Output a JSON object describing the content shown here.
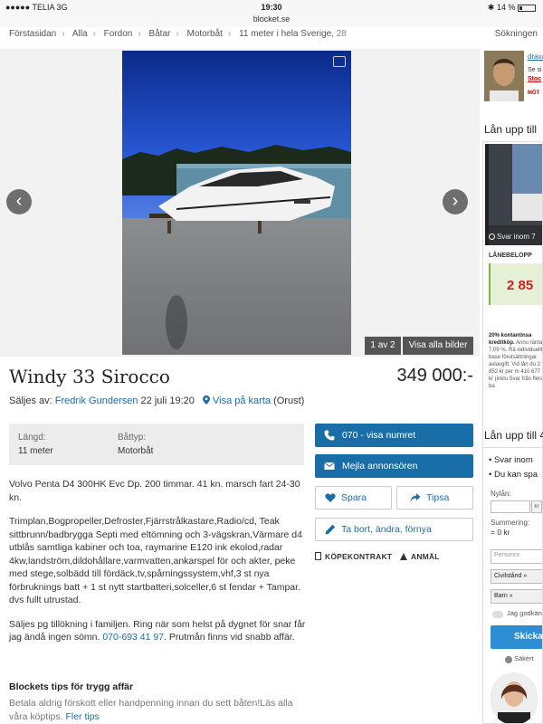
{
  "status_bar": {
    "carrier": "●●●●● TELIA  3G",
    "time": "19:30",
    "url": "blocket.se",
    "battery": "✱ 14 %"
  },
  "breadcrumb": {
    "items": [
      "Förstasidan",
      "Alla",
      "Fordon",
      "Båtar",
      "Motorbåt",
      "11 meter i hela Sverige,"
    ],
    "count": "28",
    "search_link": "Sökningen"
  },
  "gallery": {
    "counter": "1 av 2",
    "show_all": "Visa alla bilder",
    "prev_icon": "chevron-left-icon",
    "next_icon": "chevron-right-icon",
    "prev_glyph": "‹",
    "next_glyph": "›"
  },
  "listing": {
    "title": "Windy 33 Sirocco",
    "price": "349 000:-",
    "seller_prefix": "Säljes av:",
    "seller_name": "Fredrik Gundersen",
    "date": "22 juli 19:20",
    "map_link": "Visa på karta",
    "location": "(Orust)"
  },
  "info": {
    "length_label": "Längd:",
    "length_value": "11 meter",
    "type_label": "Båttyp:",
    "type_value": "Motorbåt"
  },
  "description": {
    "p1": "Volvo Penta D4 300HK Evc Dp. 200 timmar. 41 kn. marsch fart 24-30 kn.",
    "p2": "Trimplan,Bogpropeller,Defroster,Fjärrstrålkastare,Radio/cd, Teak sittbrunn/badbrygga Septi med eltömning och 3-vägskran,Värmare d4 utblås samtliga kabiner och toa, raymarine E120 ink ekolod,radar 4kw,landström,dildohållare,varmvatten,ankarspel för och akter, peke med stege,solbädd till fördäck,tv,spårningssystem,vhf,3 st nya förbruknings batt + 1 st nytt startbatteri,solceller,6 st fendar + Tampar. dvs fullt utrustad.",
    "p3_text": "Säljes pg tillökning i familjen. Ring när som helst på dygnet för snar får jag ändå ingen sömn.",
    "p3_phone": "070-693 41 97",
    "p3_end": ". Prutmån finns vid snabb affär."
  },
  "tips": {
    "title": "Blockets tips för trygg affär",
    "text": "Betala aldrig förskott eller handpenning innan du sett båten!Läs alla våra köptips.",
    "link": "Fler tips"
  },
  "actions": {
    "phone": "070 - visa numret",
    "mail": "Mejla annonsören",
    "save": "Spara",
    "share": "Tipsa",
    "edit": "Ta bort, ändra, förnya",
    "contract": "KÖPEKONTRAKT",
    "report": "ANMÄL"
  },
  "right_column": {
    "ad_name": "drava",
    "ad_line1": "Se si",
    "ad_line2": "Stoc",
    "ad_line3": "MÖT",
    "loan_title_1": "Lån upp till",
    "loan_photo_caption": "Svar inom 7",
    "loan_label": "LÅNEBELOPP",
    "loan_amount": "2 85",
    "loan_fine_bold": "20% kontantinsa kreditköp.",
    "loan_fine": "Annu ränta 7.09 %. Rä individuellt base förutsättningar. aviavgift. Vid lån du 2 852 kr per m 410 677 kr (inklu Svar från flera ba",
    "loan_title_2": "Lån upp till 4",
    "bullet_1": "•  Svar inom",
    "bullet_2": "•  Du kan spa",
    "nylan_label": "Nylån:",
    "kr_label": "kr",
    "sum_label": "Summering:",
    "sum_value": "= 0 kr",
    "person_placeholder": "Personnr",
    "civil_select": "Civilstånd »",
    "barn_select": "Barn »",
    "agree": "Jag godkän",
    "submit": "Skicka",
    "secure": "Säkert"
  }
}
